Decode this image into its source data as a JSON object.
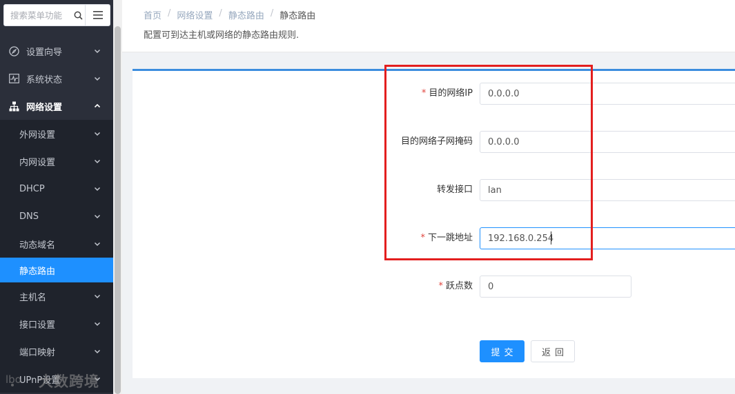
{
  "sidebar": {
    "search_placeholder": "搜索菜单功能",
    "items": [
      {
        "label": "设置向导"
      },
      {
        "label": "系统状态"
      },
      {
        "label": "网络设置"
      }
    ],
    "sub_items": [
      {
        "label": "外网设置"
      },
      {
        "label": "内网设置"
      },
      {
        "label": "DHCP"
      },
      {
        "label": "DNS"
      },
      {
        "label": "动态域名"
      },
      {
        "label": "静态路由"
      },
      {
        "label": "主机名"
      },
      {
        "label": "接口设置"
      },
      {
        "label": "端口映射"
      },
      {
        "label": "UPnP设置"
      }
    ]
  },
  "breadcrumb": {
    "items": [
      "首页",
      "网络设置",
      "静态路由",
      "静态路由"
    ],
    "separator": "/"
  },
  "page": {
    "description": "配置可到达主机或网络的静态路由规则."
  },
  "form": {
    "required_mark": "*",
    "dest_ip": {
      "label": "目的网络IP",
      "value": "0.0.0.0"
    },
    "dest_mask": {
      "label": "目的网络子网掩码",
      "value": "0.0.0.0"
    },
    "interface": {
      "label": "转发接口",
      "value": "lan"
    },
    "next_hop": {
      "label": "下一跳地址",
      "value": "192.168.0.254"
    },
    "hops": {
      "label": "跃点数",
      "value": "0"
    },
    "submit_label": "提交",
    "back_label": "返回"
  },
  "watermark": {
    "text": "大数跨境"
  },
  "colors": {
    "sidebar_bg": "#2b2f3a",
    "active": "#1e90ff",
    "highlight": "#e31e1e",
    "required": "#e0443d"
  }
}
